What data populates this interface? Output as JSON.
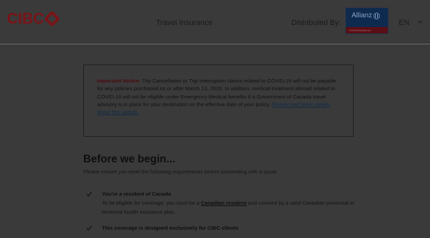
{
  "brand": {
    "logo_text": "CIBC"
  },
  "header": {
    "title": "Travel Insurance",
    "distributed_label": "Distributed By:",
    "partner_logo_text": "Allianz",
    "partner_strip_text": "Global Assistance",
    "language": "EN"
  },
  "notice": {
    "label": "Important Notice:",
    "text": " Trip Cancellation or Trip Interruption claims related to COVID-19 will not be payable for any policies purchased on or after March 13, 2020. In addition, medical treatment abroad related to COVID-19 will not be eligible under Emergency Medical benefits if a Government of Canada travel advisory is in place for your destination on the effective date of your policy. ",
    "link": "Please read more details about this update."
  },
  "intro": {
    "heading": "Before we begin...",
    "subheading": "Please ensure you meet the following requirements before proceeding with a quote."
  },
  "requirements": [
    {
      "title": "You're a resident of Canada",
      "body_before": "To be eligible for coverage, you must be a ",
      "body_link": "Canadian resident",
      "body_after": " and covered by a valid Canadian provincial or territorial health insurance plan."
    },
    {
      "title": "This coverage is designed exclusively for CIBC clients"
    }
  ]
}
